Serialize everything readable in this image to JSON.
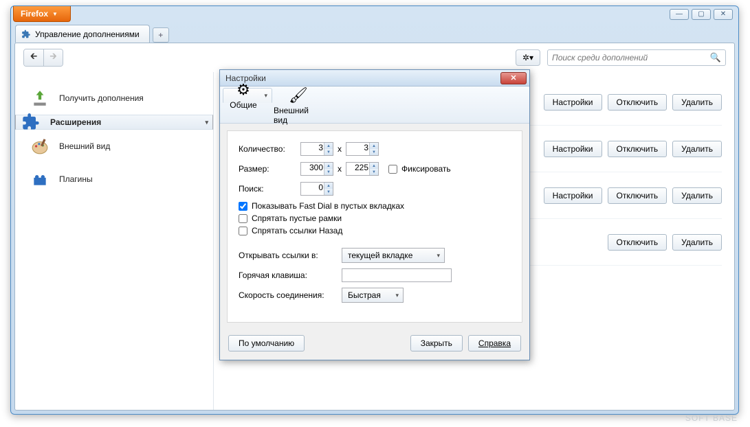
{
  "app": {
    "menu_label": "Firefox"
  },
  "tab": {
    "title": "Управление дополнениями"
  },
  "toolbar": {
    "search_placeholder": "Поиск среди дополнений"
  },
  "sidebar": {
    "items": [
      {
        "label": "Получить дополнения"
      },
      {
        "label": "Расширения"
      },
      {
        "label": "Внешний вид"
      },
      {
        "label": "Плагины"
      }
    ]
  },
  "buttons": {
    "settings": "Настройки",
    "disable": "Отключить",
    "remove": "Удалить"
  },
  "addons": [
    {
      "has_settings": true
    },
    {
      "has_settings": true
    },
    {
      "has_settings": true
    },
    {
      "has_settings": false
    }
  ],
  "dialog": {
    "title": "Настройки",
    "tabs": {
      "general": "Общие",
      "appearance": "Внешний вид"
    },
    "labels": {
      "count": "Количество:",
      "size": "Размер:",
      "search": "Поиск:",
      "fix": "Фиксировать",
      "show_empty": "Показывать Fast Dial в пустых вкладках",
      "hide_frames": "Спрятать пустые рамки",
      "hide_back": "Спрятать ссылки Назад",
      "open_in": "Открывать ссылки в:",
      "hotkey": "Горячая клавиша:",
      "speed": "Скорость соединения:"
    },
    "values": {
      "count_x": "3",
      "count_y": "3",
      "size_w": "300",
      "size_h": "225",
      "search": "0",
      "fix": false,
      "show_empty": true,
      "hide_frames": false,
      "hide_back": false,
      "open_in": "текущей вкладке",
      "hotkey": "",
      "speed": "Быстрая"
    },
    "footer": {
      "defaults": "По умолчанию",
      "close": "Закрыть",
      "help": "Справка"
    }
  },
  "watermark": "SOFT   BASE"
}
